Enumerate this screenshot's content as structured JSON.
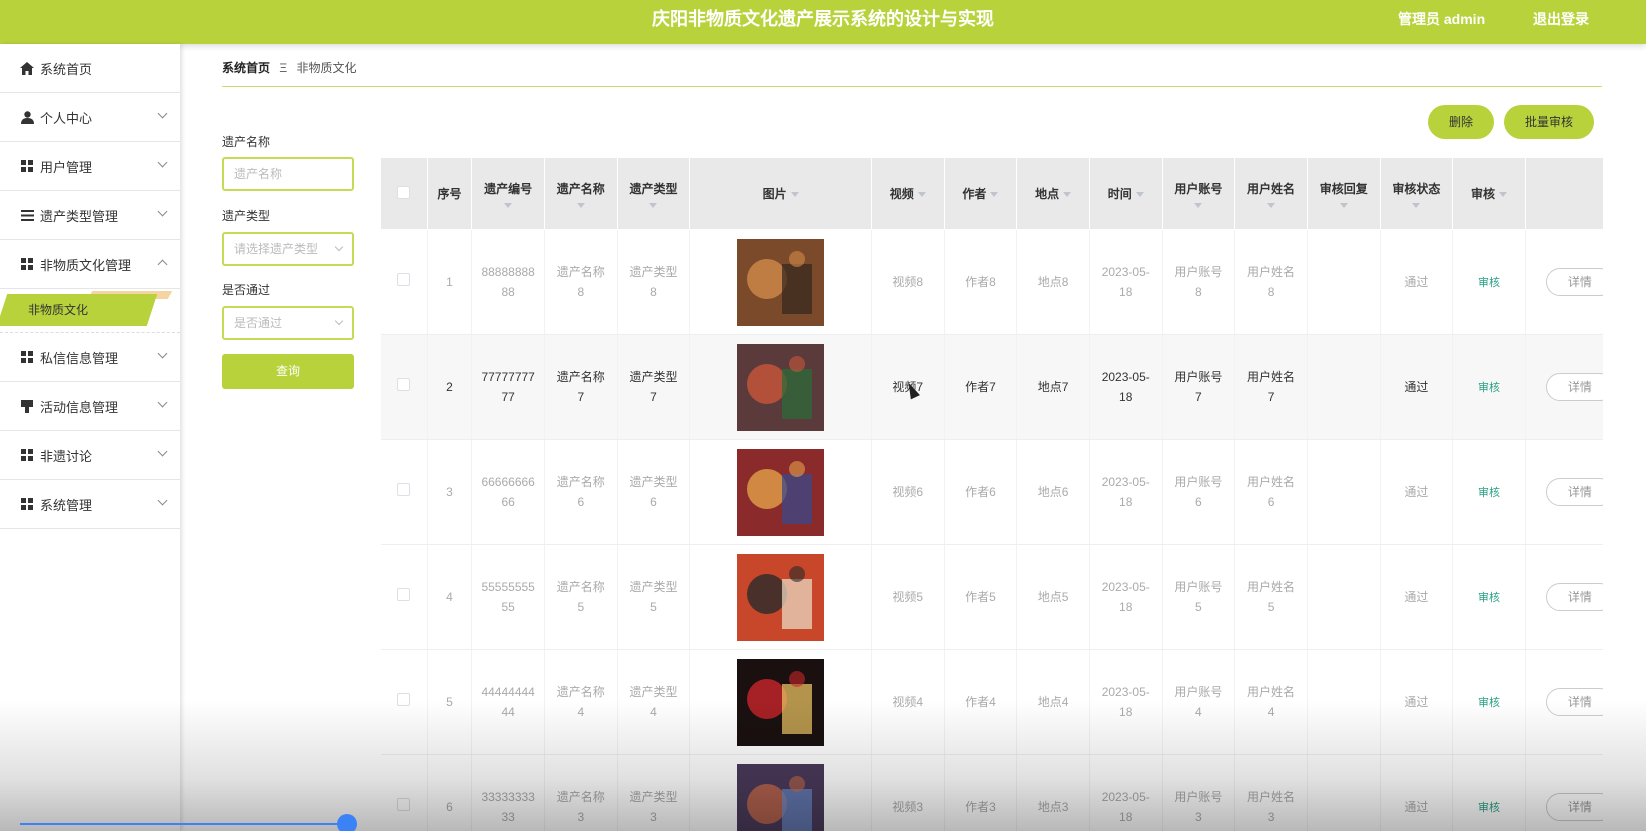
{
  "header": {
    "title": "庆阳非物质文化遗产展示系统的设计与实现",
    "user": "管理员 admin",
    "logout": "退出登录"
  },
  "sidebar": {
    "items": [
      {
        "label": "系统首页",
        "icon": "home-icon"
      },
      {
        "label": "个人中心",
        "icon": "user-icon"
      },
      {
        "label": "用户管理",
        "icon": "grid-icon"
      },
      {
        "label": "遗产类型管理",
        "icon": "list-icon"
      },
      {
        "label": "非物质文化管理",
        "icon": "grid-icon"
      },
      {
        "label": "私信信息管理",
        "icon": "grid-icon"
      },
      {
        "label": "活动信息管理",
        "icon": "pin-icon"
      },
      {
        "label": "非遗讨论",
        "icon": "grid-icon"
      },
      {
        "label": "系统管理",
        "icon": "grid-icon"
      }
    ],
    "active_sub": "非物质文化"
  },
  "breadcrumb": {
    "home": "系统首页",
    "sep": "Ξ",
    "current": "非物质文化"
  },
  "filters": {
    "name_label": "遗产名称",
    "name_placeholder": "遗产名称",
    "type_label": "遗产类型",
    "type_placeholder": "请选择遗产类型",
    "pass_label": "是否通过",
    "pass_placeholder": "是否通过",
    "query": "查询"
  },
  "actions": {
    "delete": "删除",
    "batch_audit": "批量审核"
  },
  "table": {
    "headers": [
      "序号",
      "遗产编号",
      "遗产名称",
      "遗产类型",
      "图片",
      "视频",
      "作者",
      "地点",
      "时间",
      "用户账号",
      "用户姓名",
      "审核回复",
      "审核状态",
      "审核"
    ],
    "rows": [
      {
        "idx": "1",
        "code": "8888888888",
        "name": "遗产名称8",
        "type": "遗产类型8",
        "video": "视频8",
        "author": "作者8",
        "place": "地点8",
        "time": "2023-05-18",
        "account": "用户账号8",
        "uname": "用户姓名8",
        "reply": "",
        "status": "通过",
        "audit": "审核",
        "detail": "详情"
      },
      {
        "idx": "2",
        "code": "7777777777",
        "name": "遗产名称7",
        "type": "遗产类型7",
        "video": "视频7",
        "author": "作者7",
        "place": "地点7",
        "time": "2023-05-18",
        "account": "用户账号7",
        "uname": "用户姓名7",
        "reply": "",
        "status": "通过",
        "audit": "审核",
        "detail": "详情"
      },
      {
        "idx": "3",
        "code": "6666666666",
        "name": "遗产名称6",
        "type": "遗产类型6",
        "video": "视频6",
        "author": "作者6",
        "place": "地点6",
        "time": "2023-05-18",
        "account": "用户账号6",
        "uname": "用户姓名6",
        "reply": "",
        "status": "通过",
        "audit": "审核",
        "detail": "详情"
      },
      {
        "idx": "4",
        "code": "5555555555",
        "name": "遗产名称5",
        "type": "遗产类型5",
        "video": "视频5",
        "author": "作者5",
        "place": "地点5",
        "time": "2023-05-18",
        "account": "用户账号5",
        "uname": "用户姓名5",
        "reply": "",
        "status": "通过",
        "audit": "审核",
        "detail": "详情"
      },
      {
        "idx": "5",
        "code": "4444444444",
        "name": "遗产名称4",
        "type": "遗产类型4",
        "video": "视频4",
        "author": "作者4",
        "place": "地点4",
        "time": "2023-05-18",
        "account": "用户账号4",
        "uname": "用户姓名4",
        "reply": "",
        "status": "通过",
        "audit": "审核",
        "detail": "详情"
      },
      {
        "idx": "6",
        "code": "3333333333",
        "name": "遗产名称3",
        "type": "遗产类型3",
        "video": "视频3",
        "author": "作者3",
        "place": "地点3",
        "time": "2023-05-18",
        "account": "用户账号3",
        "uname": "用户姓名3",
        "reply": "",
        "status": "通过",
        "audit": "审核",
        "detail": "详情"
      }
    ]
  },
  "colors": {
    "accent": "#b8d23c",
    "link": "#2aa186",
    "header_bg": "#e9e9e9"
  }
}
